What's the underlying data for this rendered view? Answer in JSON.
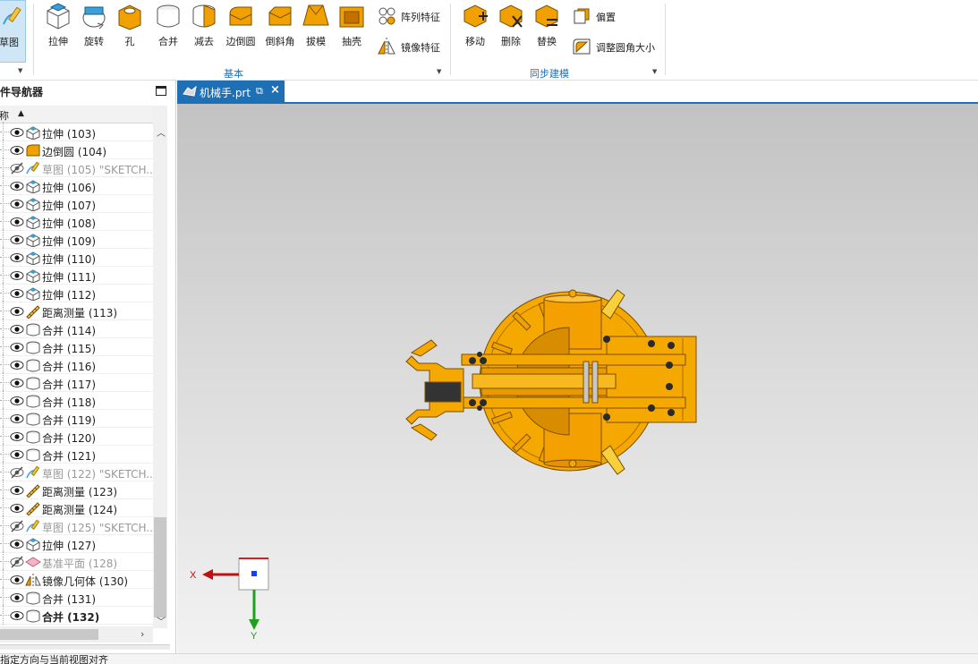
{
  "ribbon": {
    "sketch_label": "草图",
    "buttons": [
      {
        "label": "拉伸",
        "icon": "extrude-icon"
      },
      {
        "label": "旋转",
        "icon": "revolve-icon"
      },
      {
        "label": "孔",
        "icon": "hole-icon"
      },
      {
        "label": "合并",
        "icon": "unite-icon"
      },
      {
        "label": "减去",
        "icon": "subtract-icon"
      },
      {
        "label": "边倒圆",
        "icon": "edge-blend-icon"
      },
      {
        "label": "倒斜角",
        "icon": "chamfer-icon"
      },
      {
        "label": "拔模",
        "icon": "draft-icon"
      },
      {
        "label": "抽壳",
        "icon": "shell-icon"
      }
    ],
    "small_buttons_basic": [
      {
        "label": "阵列特征",
        "icon": "pattern-feature-icon"
      },
      {
        "label": "镜像特征",
        "icon": "mirror-feature-icon"
      }
    ],
    "basic_group_label": "基本",
    "sync_buttons": [
      {
        "label": "移动",
        "icon": "move-face-icon"
      },
      {
        "label": "删除",
        "icon": "delete-face-icon"
      },
      {
        "label": "替换",
        "icon": "replace-face-icon"
      }
    ],
    "small_buttons_sync": [
      {
        "label": "偏置",
        "icon": "offset-region-icon"
      },
      {
        "label": "调整圆角大小",
        "icon": "resize-blend-icon"
      }
    ],
    "sync_group_label": "同步建模"
  },
  "navigator": {
    "title": "部件导航器",
    "column_header": "名称",
    "rows": [
      {
        "label": "拉伸 (103)",
        "type": "extrude",
        "visible": true
      },
      {
        "label": "边倒圆 (104)",
        "type": "blend",
        "visible": true
      },
      {
        "label": "草图 (105) \"SKETCH...",
        "type": "sketch",
        "visible": false
      },
      {
        "label": "拉伸 (106)",
        "type": "extrude",
        "visible": true
      },
      {
        "label": "拉伸 (107)",
        "type": "extrude",
        "visible": true
      },
      {
        "label": "拉伸 (108)",
        "type": "extrude",
        "visible": true
      },
      {
        "label": "拉伸 (109)",
        "type": "extrude",
        "visible": true
      },
      {
        "label": "拉伸 (110)",
        "type": "extrude",
        "visible": true
      },
      {
        "label": "拉伸 (111)",
        "type": "extrude",
        "visible": true
      },
      {
        "label": "拉伸 (112)",
        "type": "extrude",
        "visible": true
      },
      {
        "label": "距离测量 (113)",
        "type": "measure",
        "visible": true
      },
      {
        "label": "合并 (114)",
        "type": "unite",
        "visible": true
      },
      {
        "label": "合并 (115)",
        "type": "unite",
        "visible": true
      },
      {
        "label": "合并 (116)",
        "type": "unite",
        "visible": true
      },
      {
        "label": "合并 (117)",
        "type": "unite",
        "visible": true
      },
      {
        "label": "合并 (118)",
        "type": "unite",
        "visible": true
      },
      {
        "label": "合并 (119)",
        "type": "unite",
        "visible": true
      },
      {
        "label": "合并 (120)",
        "type": "unite",
        "visible": true
      },
      {
        "label": "合并 (121)",
        "type": "unite",
        "visible": true
      },
      {
        "label": "草图 (122) \"SKETCH...",
        "type": "sketch",
        "visible": false
      },
      {
        "label": "距离测量 (123)",
        "type": "measure",
        "visible": true
      },
      {
        "label": "距离测量 (124)",
        "type": "measure",
        "visible": true
      },
      {
        "label": "草图 (125) \"SKETCH...",
        "type": "sketch",
        "visible": false
      },
      {
        "label": "拉伸 (127)",
        "type": "extrude",
        "visible": true,
        "info": true
      },
      {
        "label": "基准平面 (128)",
        "type": "datum",
        "visible": false
      },
      {
        "label": "镜像几何体 (130)",
        "type": "mirror",
        "visible": true
      },
      {
        "label": "合并 (131)",
        "type": "unite",
        "visible": true
      },
      {
        "label": "合并 (132)",
        "type": "unite",
        "visible": true,
        "bold": true
      }
    ]
  },
  "tab": {
    "title": "机械手.prt"
  },
  "triad": {
    "x_label": "X",
    "y_label": "Y"
  },
  "status_text": "指定方向与当前视图对齐",
  "colors": {
    "accent": "#1f6fb5",
    "model_orange": "#f0a800"
  }
}
